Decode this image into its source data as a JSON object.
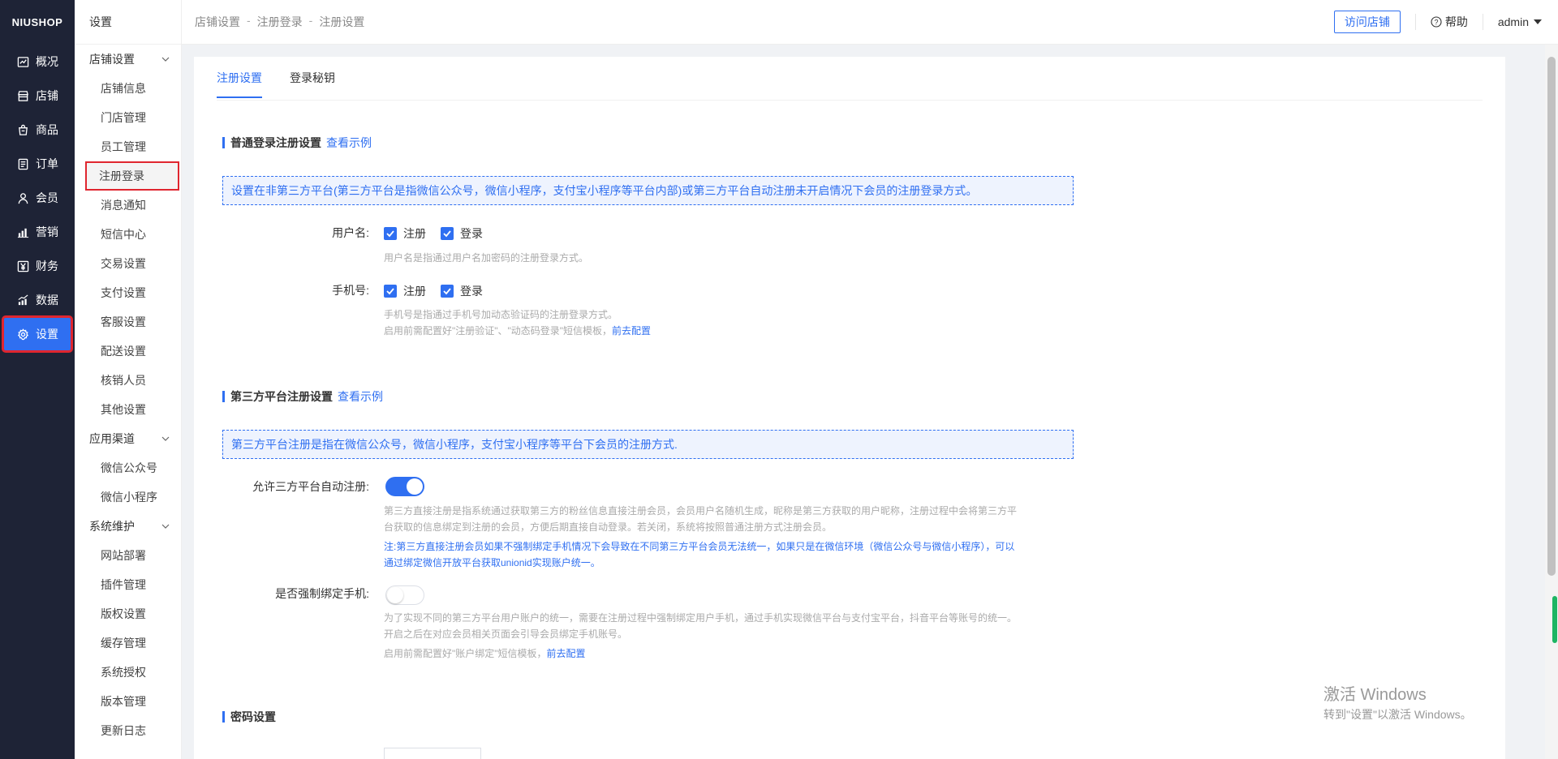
{
  "logo": "NIUSHOP",
  "nav": [
    {
      "label": "概况",
      "icon": "chart-icon",
      "active": false
    },
    {
      "label": "店铺",
      "icon": "store-icon",
      "active": false
    },
    {
      "label": "商品",
      "icon": "product-icon",
      "active": false
    },
    {
      "label": "订单",
      "icon": "order-icon",
      "active": false
    },
    {
      "label": "会员",
      "icon": "member-icon",
      "active": false
    },
    {
      "label": "营销",
      "icon": "marketing-icon",
      "active": false
    },
    {
      "label": "财务",
      "icon": "finance-icon",
      "active": false
    },
    {
      "label": "数据",
      "icon": "data-icon",
      "active": false
    },
    {
      "label": "设置",
      "icon": "gear-icon",
      "active": true
    }
  ],
  "submenu": {
    "title": "设置",
    "groups": [
      {
        "label": "店铺设置",
        "items": [
          "店铺信息",
          "门店管理",
          "员工管理",
          "注册登录",
          "消息通知",
          "短信中心",
          "交易设置",
          "支付设置",
          "客服设置",
          "配送设置",
          "核销人员",
          "其他设置"
        ]
      },
      {
        "label": "应用渠道",
        "items": [
          "微信公众号",
          "微信小程序"
        ]
      },
      {
        "label": "系统维护",
        "items": [
          "网站部署",
          "插件管理",
          "版权设置",
          "缓存管理",
          "系统授权",
          "版本管理",
          "更新日志"
        ]
      }
    ],
    "active_item": "注册登录"
  },
  "breadcrumb": [
    "店铺设置",
    "注册登录",
    "注册设置"
  ],
  "breadcrumb_sep": "-",
  "header": {
    "visit_store": "访问店铺",
    "help": "帮助",
    "user": "admin"
  },
  "tabs": [
    {
      "label": "注册设置",
      "active": true
    },
    {
      "label": "登录秘钥",
      "active": false
    }
  ],
  "section1": {
    "title": "普通登录注册设置",
    "link": "查看示例",
    "tip": "设置在非第三方平台(第三方平台是指微信公众号，微信小程序，支付宝小程序等平台内部)或第三方平台自动注册未开启情况下会员的注册登录方式。",
    "username": {
      "label": "用户名:",
      "options": [
        {
          "label": "注册",
          "checked": true
        },
        {
          "label": "登录",
          "checked": true
        }
      ],
      "help": "用户名是指通过用户名加密码的注册登录方式。"
    },
    "mobile": {
      "label": "手机号:",
      "options": [
        {
          "label": "注册",
          "checked": true
        },
        {
          "label": "登录",
          "checked": true
        }
      ],
      "help": "手机号是指通过手机号加动态验证码的注册登录方式。",
      "help2": "启用前需配置好\"注册验证\"、\"动态码登录\"短信模板，",
      "help2_link": "前去配置"
    }
  },
  "section2": {
    "title": "第三方平台注册设置",
    "link": "查看示例",
    "tip": "第三方平台注册是指在微信公众号，微信小程序，支付宝小程序等平台下会员的注册方式.",
    "auto_register": {
      "label": "允许三方平台自动注册:",
      "on": true,
      "help_line1": "第三方直接注册是指系统通过获取第三方的粉丝信息直接注册会员，会员用户名随机生成，昵称是第三方获取的用户昵称，注册过程中会将第三方平",
      "help_line2": "台获取的信息绑定到注册的会员，方便后期直接自动登录。若关闭，系统将按照普通注册方式注册会员。",
      "note_line1": "注:第三方直接注册会员如果不强制绑定手机情况下会导致在不同第三方平台会员无法统一，如果只是在微信环境（微信公众号与微信小程序），可以",
      "note_line2": "通过绑定微信开放平台获取unionid实现账户统一。"
    },
    "force_bind": {
      "label": "是否强制绑定手机:",
      "on": false,
      "help_line1": "为了实现不同的第三方平台用户账户的统一，需要在注册过程中强制绑定用户手机，通过手机实现微信平台与支付宝平台，抖音平台等账号的统一。",
      "help_line2": "开启之后在对应会员相关页面会引导会员绑定手机账号。",
      "help3": "启用前需配置好\"账户绑定\"短信模板，",
      "help3_link": "前去配置"
    }
  },
  "section3": {
    "title": "密码设置"
  },
  "watermark": {
    "line1": "激活 Windows",
    "line2": "转到\"设置\"以激活 Windows。"
  },
  "colors": {
    "accent": "#2f6ff1",
    "nav_bg": "#1e2336",
    "highlight": "#e0262f"
  }
}
